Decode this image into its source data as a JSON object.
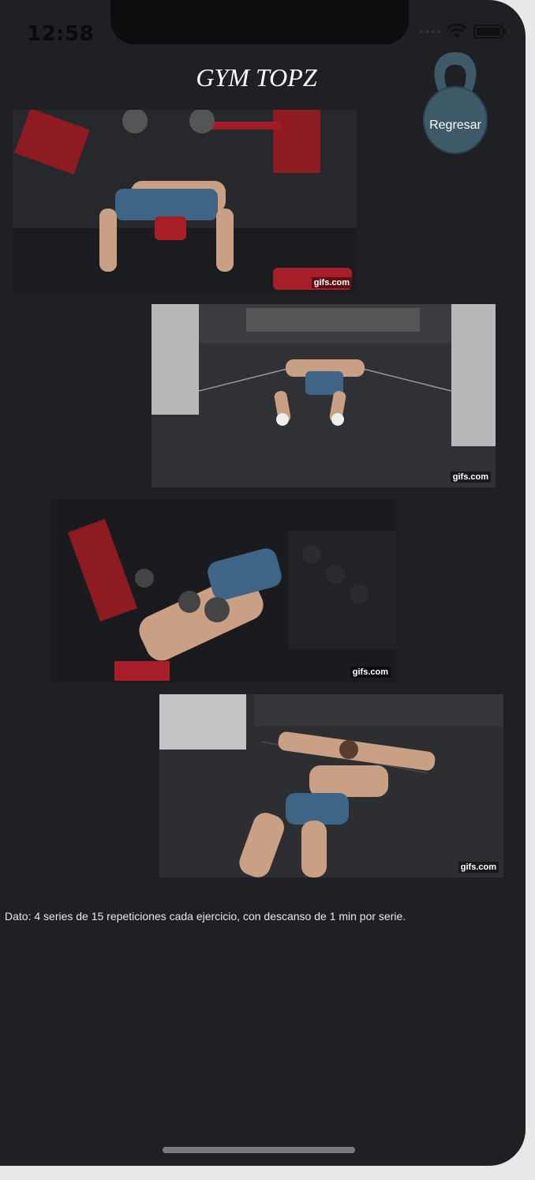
{
  "status_bar": {
    "time": "12:58"
  },
  "app": {
    "title": "GYM TOPZ"
  },
  "back_button": {
    "label": "Regresar",
    "icon": "kettlebell-icon"
  },
  "gifs": [
    {
      "watermark": "gifs.com",
      "scene": "dumbbell-bench-press"
    },
    {
      "watermark": "gifs.com",
      "scene": "floor-cable-fly"
    },
    {
      "watermark": "gifs.com",
      "scene": "incline-dumbbell-press"
    },
    {
      "watermark": "gifs.com",
      "scene": "floor-cable-fly"
    }
  ],
  "note": {
    "text": "Dato: 4 series de 15 repeticiones cada ejercicio, con descanso de 1 min por serie."
  },
  "colors": {
    "background": "#1f2023",
    "kettlebell": "#3e5968",
    "text": "#ffffff"
  }
}
